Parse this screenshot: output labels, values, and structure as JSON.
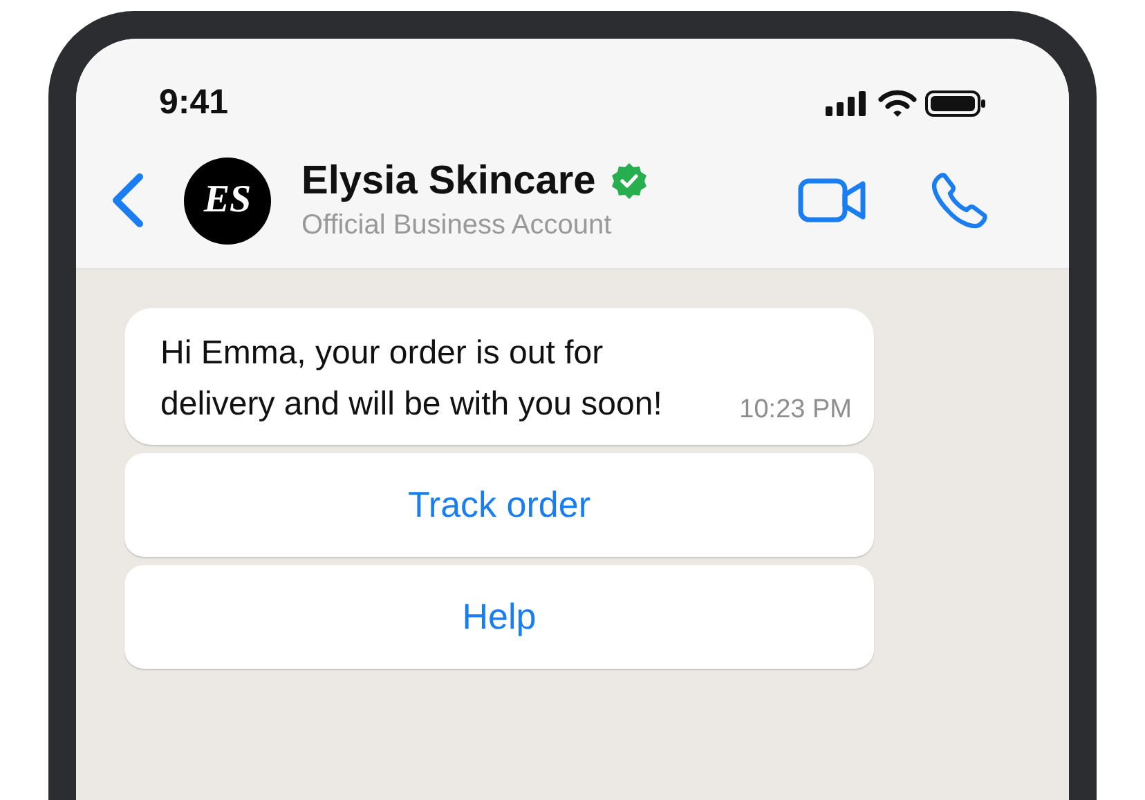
{
  "status_bar": {
    "time": "9:41"
  },
  "chat_header": {
    "avatar_monogram": "ES",
    "name": "Elysia Skincare",
    "verified": true,
    "subtitle": "Official Business Account"
  },
  "messages": [
    {
      "text": "Hi Emma, your order is out for delivery and will be with you soon!",
      "time": "10:23 PM",
      "quick_replies": [
        "Track order",
        "Help"
      ]
    }
  ]
}
